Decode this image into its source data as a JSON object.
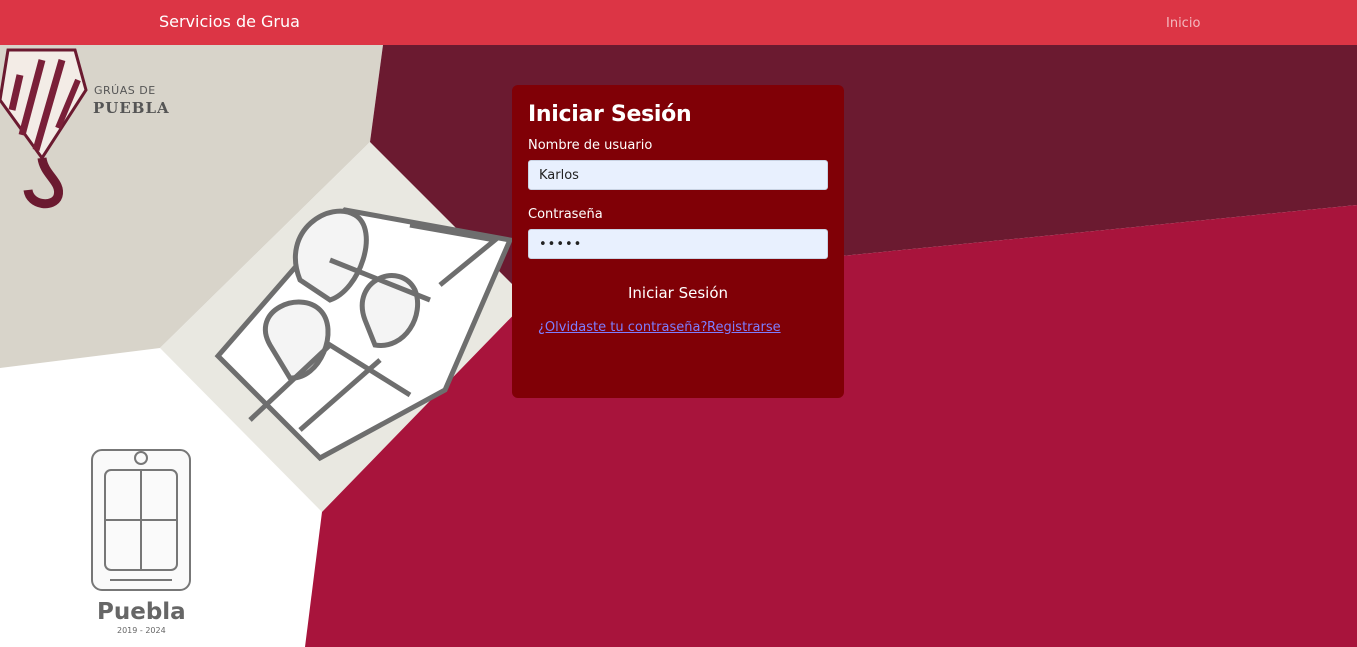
{
  "navbar": {
    "brand": "Servicios de Grua",
    "links": [
      {
        "label": "Inicio"
      }
    ],
    "color": "#dc3545"
  },
  "background": {
    "logo_top": "GRÚAS DE",
    "logo_bottom": "PUEBLA",
    "emblem_name": "Puebla",
    "emblem_years": "2019 - 2024",
    "colors": {
      "wine": "#6b1a30",
      "crimson": "#a8143c",
      "beige": "#d8d4ca",
      "light": "#e9e8e1"
    }
  },
  "login": {
    "title": "Iniciar Sesión",
    "username_label": "Nombre de usuario",
    "username_value": "Karlos",
    "password_label": "Contraseña",
    "password_value": "•••••",
    "submit_label": "Iniciar Sesión",
    "forgot_link": "¿Olvidaste tu contraseña?",
    "register_link": "Registrarse",
    "card_color": "#800006"
  }
}
